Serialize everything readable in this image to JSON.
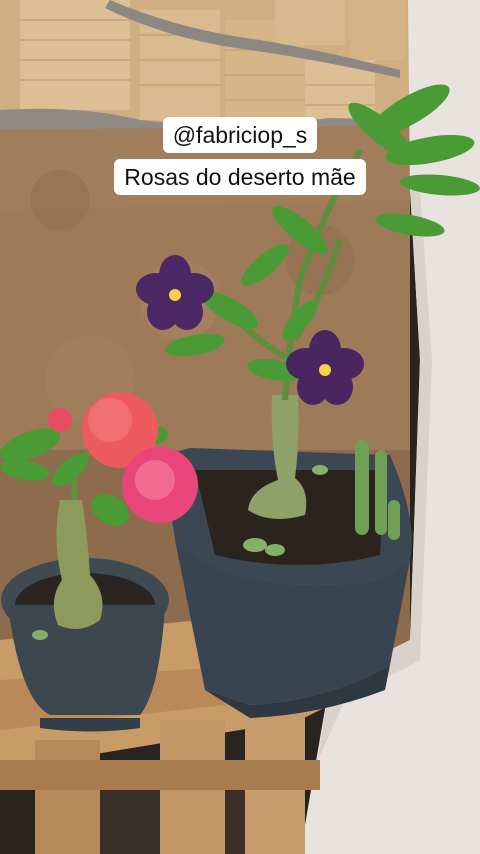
{
  "overlay": {
    "line1": "@fabriciop_s",
    "line2": "Rosas do deserto mãe"
  },
  "colors": {
    "wall_bricks": "#d8b98e",
    "wall_mud": "#9a7755",
    "plaster_wall": "#e9e4df",
    "pot": "#3d4a55",
    "wood": "#c79a68",
    "leaf": "#3f8f2f",
    "purple_flower": "#4a2560",
    "pink_flower": "#ea4a6a"
  }
}
